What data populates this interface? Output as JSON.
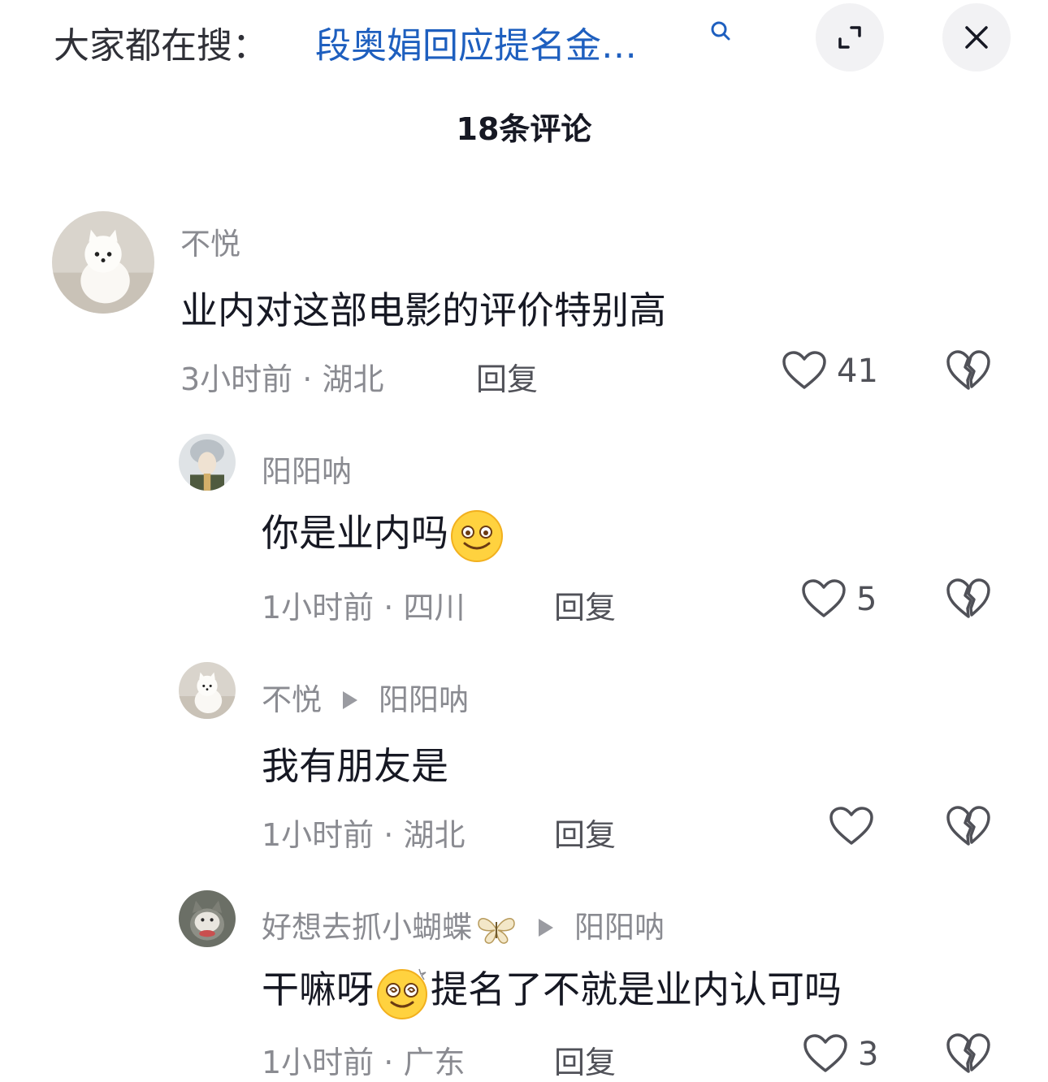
{
  "search": {
    "prefix": "大家都在搜：",
    "query": "段奥娟回应提名金…"
  },
  "header": {
    "comment_count": "18条评论"
  },
  "comments": [
    {
      "username": "不悦",
      "text": "业内对这部电影的评价特别高",
      "time": "3小时前",
      "location": "湖北",
      "reply_label": "回复",
      "likes": "41",
      "avatar": "white-dog-avatar"
    },
    {
      "username": "阳阳呐",
      "text": "你是业内吗",
      "emoji": "smiling-face-emoji",
      "time": "1小时前",
      "location": "四川",
      "reply_label": "回复",
      "likes": "5",
      "avatar": "gray-hair-character-avatar"
    },
    {
      "username": "不悦",
      "reply_to": "阳阳呐",
      "text": "我有朋友是",
      "time": "1小时前",
      "location": "湖北",
      "reply_label": "回复",
      "likes": "",
      "avatar": "white-dog-avatar"
    },
    {
      "username": "好想去抓小蝴蝶",
      "username_icon": "butterfly-icon",
      "reply_to": "阳阳呐",
      "text_before": "干嘛呀",
      "emoji": "dizzy-face-emoji",
      "text_after": "提名了不就是业内认可吗",
      "time": "1小时前",
      "location": "广东",
      "reply_label": "回复",
      "likes": "3",
      "avatar": "cat-avatar"
    }
  ],
  "colors": {
    "link": "#1e5fbf",
    "text": "#161823",
    "muted": "#8a8b91"
  }
}
